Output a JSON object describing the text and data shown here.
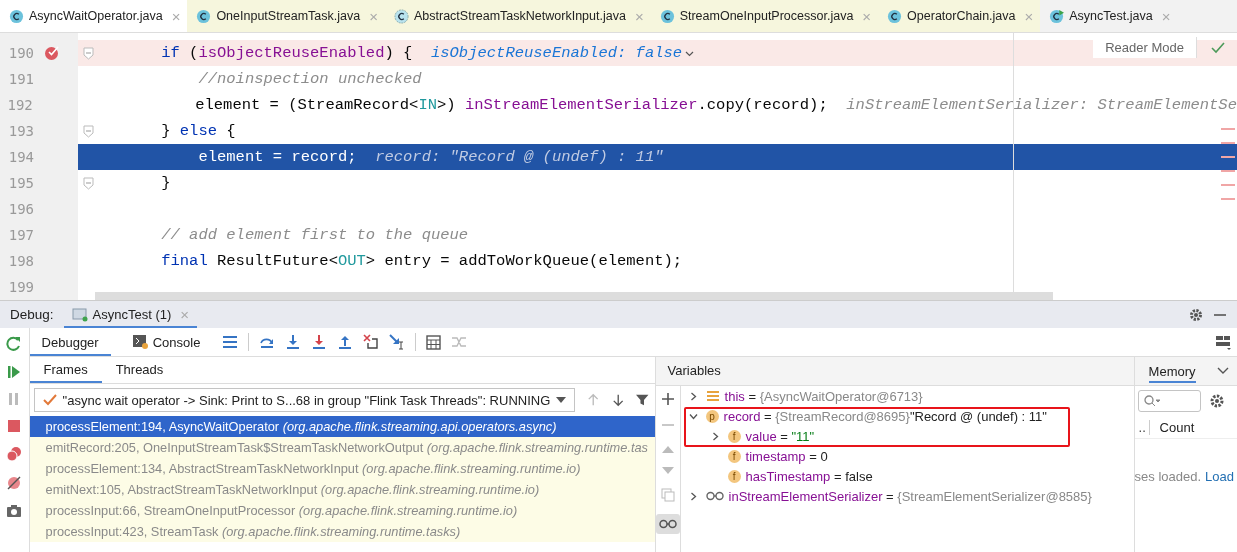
{
  "editor_tabs": [
    {
      "label": "AsyncWaitOperator.java",
      "selected": true,
      "kind": "class",
      "close": "×"
    },
    {
      "label": "OneInputStreamTask.java",
      "selected": false,
      "kind": "class",
      "close": "×"
    },
    {
      "label": "AbstractStreamTaskNetworkInput.java",
      "selected": false,
      "kind": "abstract",
      "close": "×"
    },
    {
      "label": "StreamOneInputProcessor.java",
      "selected": false,
      "kind": "class",
      "close": "×"
    },
    {
      "label": "OperatorChain.java",
      "selected": false,
      "kind": "class",
      "close": "×"
    },
    {
      "label": "AsyncTest.java",
      "selected": false,
      "kind": "runnable",
      "close": "×"
    }
  ],
  "editor": {
    "reader_mode": "Reader Mode",
    "lines": [
      {
        "number": "190",
        "breakpoint": true,
        "current": false,
        "fold": true,
        "tokens": [
          {
            "text": "    if",
            "kind": "keyword"
          },
          {
            "text": " (",
            "kind": "plain"
          },
          {
            "text": "isObjectReuseEnabled",
            "kind": "field"
          },
          {
            "text": ") {  ",
            "kind": "plain"
          },
          {
            "text": "isObjectReuseEnabled: false",
            "kind": "value_hint"
          }
        ]
      },
      {
        "number": "191",
        "breakpoint": false,
        "current": false,
        "tokens": [
          {
            "text": "        //noinspection unchecked",
            "kind": "comment"
          }
        ]
      },
      {
        "number": "192",
        "breakpoint": false,
        "current": false,
        "tokens": [
          {
            "text": "        element = (StreamRecord<",
            "kind": "plain"
          },
          {
            "text": "IN",
            "kind": "param"
          },
          {
            "text": ">) ",
            "kind": "plain"
          },
          {
            "text": "inStreamElementSerializer",
            "kind": "field"
          },
          {
            "text": ".copy(record);  ",
            "kind": "plain"
          },
          {
            "text": "inStreamElementSerializer: StreamElementSe",
            "kind": "hint"
          }
        ]
      },
      {
        "number": "193",
        "breakpoint": false,
        "current": false,
        "fold": true,
        "tokens": [
          {
            "text": "    } ",
            "kind": "plain"
          },
          {
            "text": "else",
            "kind": "keyword"
          },
          {
            "text": " {",
            "kind": "plain"
          }
        ]
      },
      {
        "number": "194",
        "breakpoint": false,
        "current": true,
        "tokens": [
          {
            "text": "        element = record;  ",
            "kind": "plain"
          },
          {
            "text": "record: \"Record @ (undef) : 11\"",
            "kind": "hint"
          }
        ]
      },
      {
        "number": "195",
        "breakpoint": false,
        "current": false,
        "fold": true,
        "tokens": [
          {
            "text": "    }",
            "kind": "plain"
          }
        ]
      },
      {
        "number": "196",
        "breakpoint": false,
        "current": false
      },
      {
        "number": "197",
        "breakpoint": false,
        "current": false,
        "tokens": [
          {
            "text": "    // add element first to the queue",
            "kind": "comment"
          }
        ]
      },
      {
        "number": "198",
        "breakpoint": false,
        "current": false,
        "tokens": [
          {
            "text": "    final",
            "kind": "keyword"
          },
          {
            "text": " ResultFuture<",
            "kind": "plain"
          },
          {
            "text": "OUT",
            "kind": "param"
          },
          {
            "text": "> entry = addToWorkQueue(element);",
            "kind": "plain"
          }
        ]
      },
      {
        "number": "199",
        "breakpoint": false,
        "current": false
      }
    ]
  },
  "debug": {
    "title": "Debug:",
    "session_tab": "AsyncTest (1)",
    "session_close": "×",
    "tabs": [
      {
        "label": "Debugger",
        "selected": true,
        "kind": "debugger"
      },
      {
        "label": "Console",
        "selected": false,
        "kind": "console"
      }
    ],
    "frame_tabs": [
      {
        "label": "Frames",
        "selected": true
      },
      {
        "label": "Threads",
        "selected": false
      }
    ],
    "thread": "\"async wait operator -> Sink: Print to S...68 in group \"Flink Task Threads\": RUNNING",
    "frames": [
      {
        "method": "processElement:194, AsyncWaitOperator",
        "package": "(org.apache.flink.streaming.api.operators.async)",
        "selected": true
      },
      {
        "method": "emitRecord:205, OneInputStreamTask$StreamTaskNetworkOutput",
        "package": "(org.apache.flink.streaming.runtime.tas",
        "selected": false
      },
      {
        "method": "processElement:134, AbstractStreamTaskNetworkInput",
        "package": "(org.apache.flink.streaming.runtime.io)",
        "selected": false
      },
      {
        "method": "emitNext:105, AbstractStreamTaskNetworkInput",
        "package": "(org.apache.flink.streaming.runtime.io)",
        "selected": false
      },
      {
        "method": "processInput:66, StreamOneInputProcessor",
        "package": "(org.apache.flink.streaming.runtime.io)",
        "selected": false
      },
      {
        "method": "processInput:423, StreamTask",
        "package": "(org.apache.flink.streaming.runtime.tasks)",
        "selected": false
      }
    ],
    "variables_title": "Variables",
    "variables": [
      {
        "name": "this",
        "assign": "=",
        "ref": "{AsyncWaitOperator@6713}",
        "kind": "this",
        "expanded": false
      },
      {
        "name": "record",
        "assign": "=",
        "ref": "{StreamRecord@8695}",
        "value": "\"Record @ (undef) : 11\"",
        "badge": "p",
        "expanded": true,
        "highlighted": true,
        "children": [
          {
            "name": "value",
            "assign": "=",
            "value": "\"11\"",
            "is_string": true,
            "badge": "f",
            "expanded": false,
            "highlighted": true
          },
          {
            "name": "timestamp",
            "assign": "=",
            "value": "0",
            "badge": "f"
          },
          {
            "name": "hasTimestamp",
            "assign": "=",
            "value": "false",
            "badge": "f"
          }
        ]
      },
      {
        "name": "inStreamElementSerializer",
        "assign": "=",
        "ref": "{StreamElementSerializer@8585}",
        "kind": "watch",
        "expanded": false
      }
    ],
    "memory": {
      "title": "Memory",
      "column_1": "..",
      "count": "Count",
      "status": "ses loaded.",
      "link": "Load"
    }
  }
}
